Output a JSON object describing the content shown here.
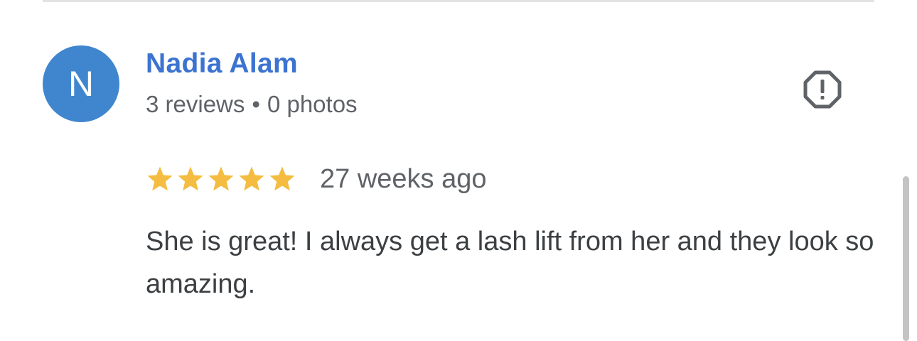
{
  "reviewer": {
    "initial": "N",
    "name": "Nadia Alam",
    "reviews": "3 reviews",
    "separator": "•",
    "photos": "0 photos",
    "avatar_color": "#3f86cf",
    "name_color": "#3c73d1"
  },
  "review": {
    "rating": 5,
    "max_rating": 5,
    "star_color": "#f4bd41",
    "time": "27 weeks ago",
    "text": "She is great! I always get a lash lift from her and they look so amazing."
  },
  "actions": {
    "report_icon": "report-octagon-icon"
  }
}
